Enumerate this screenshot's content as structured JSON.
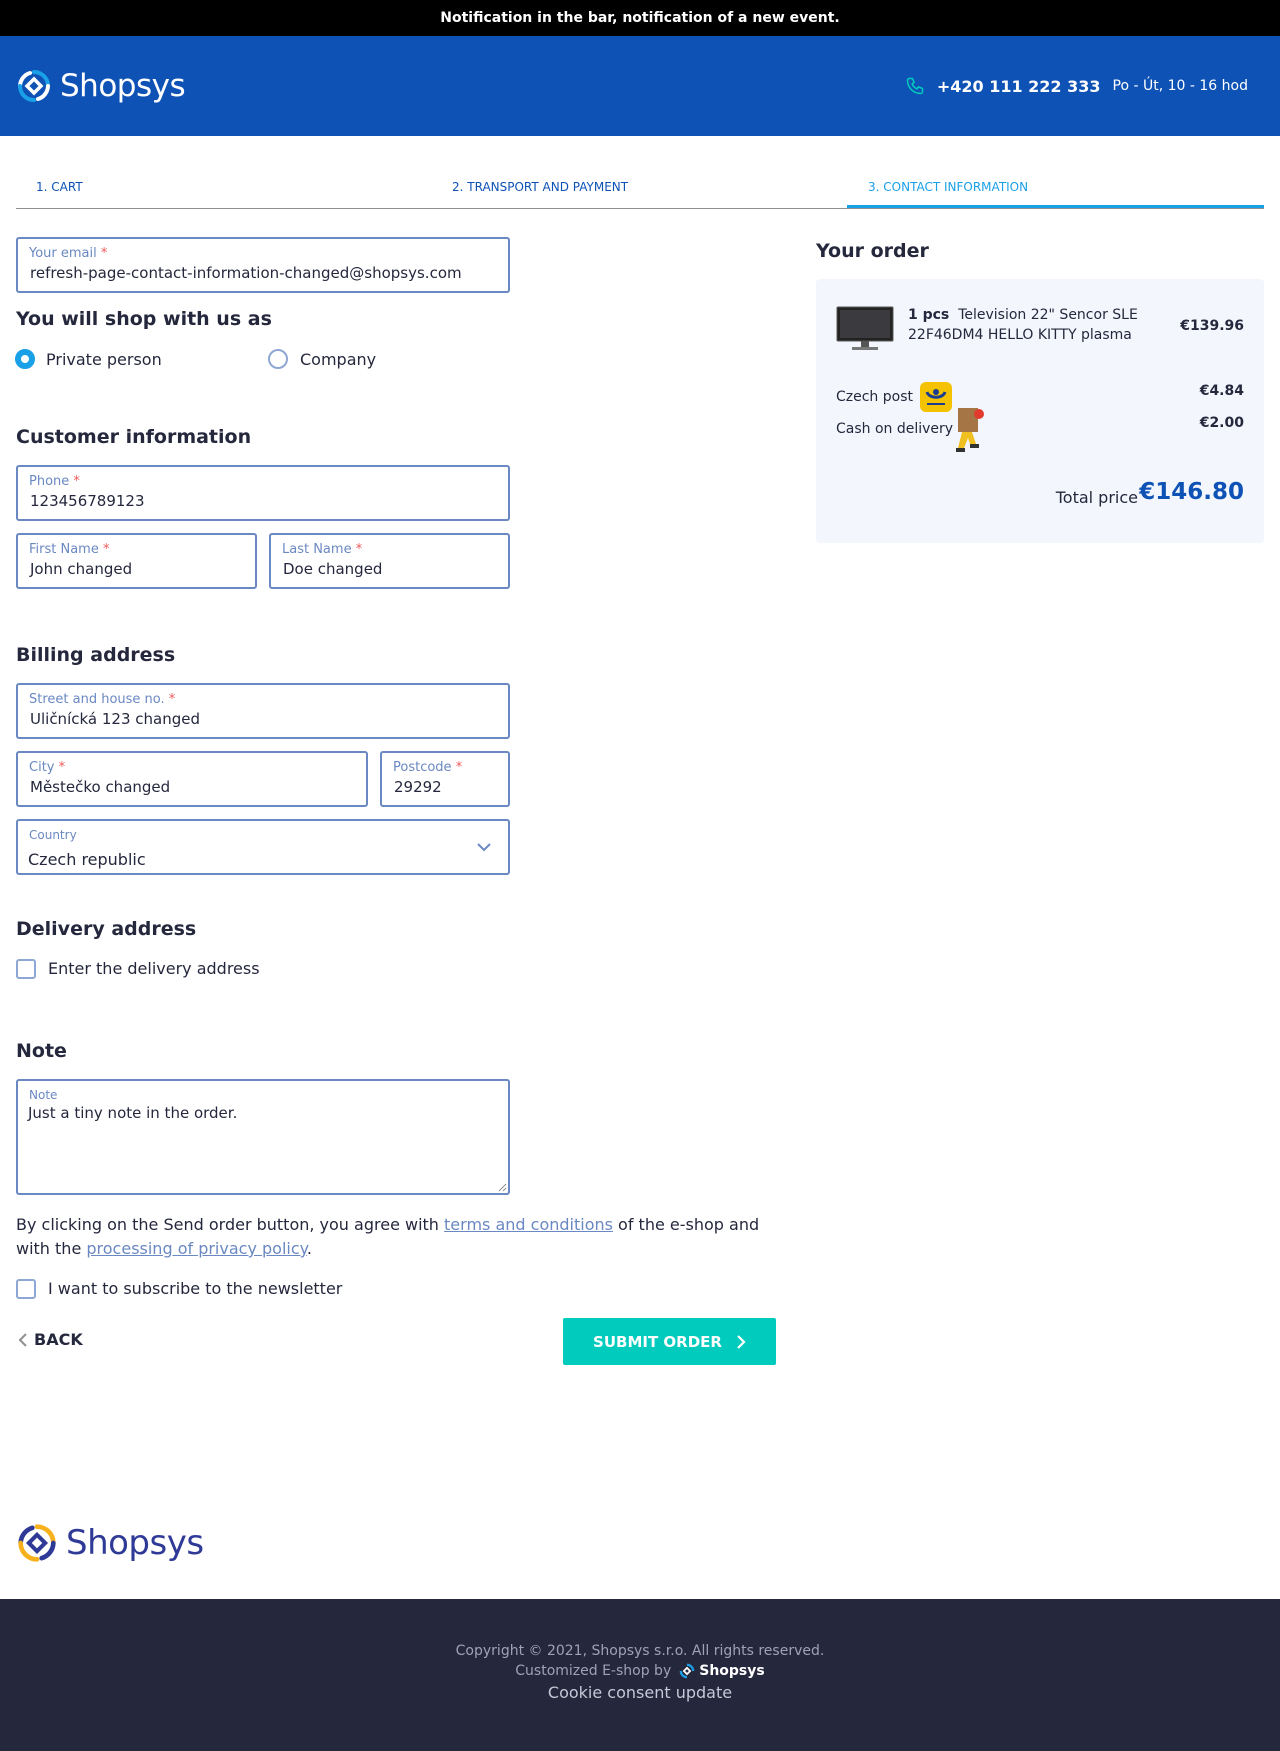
{
  "notification": "Notification in the bar, notification of a new event.",
  "header": {
    "logo_text": "Shopsys",
    "phone": "+420 111 222 333",
    "hours": "Po - Út, 10 - 16 hod"
  },
  "steps": [
    {
      "label": "1. CART"
    },
    {
      "label": "2. TRANSPORT AND PAYMENT"
    },
    {
      "label": "3. CONTACT INFORMATION"
    }
  ],
  "email": {
    "label": "Your email",
    "value": "refresh-page-contact-information-changed@shopsys.com"
  },
  "shop_as": {
    "title": "You will shop with us as",
    "options": [
      {
        "label": "Private person",
        "checked": true
      },
      {
        "label": "Company",
        "checked": false
      }
    ]
  },
  "customer": {
    "title": "Customer information",
    "phone": {
      "label": "Phone",
      "value": "123456789123"
    },
    "first_name": {
      "label": "First Name",
      "value": "John changed"
    },
    "last_name": {
      "label": "Last Name",
      "value": "Doe changed"
    }
  },
  "billing": {
    "title": "Billing address",
    "street": {
      "label": "Street and house no.",
      "value": "Uličnícká 123 changed"
    },
    "city": {
      "label": "City",
      "value": "Městečko changed"
    },
    "postcode": {
      "label": "Postcode",
      "value": "29292"
    },
    "country": {
      "label": "Country",
      "value": "Czech republic"
    }
  },
  "delivery": {
    "title": "Delivery address",
    "checkbox_label": "Enter the delivery address"
  },
  "note": {
    "title": "Note",
    "label": "Note",
    "value": "Just a tiny note in the order."
  },
  "legal": {
    "before": "By clicking on the Send order button, you agree with ",
    "terms_link": "terms and conditions",
    "middle": " of the e-shop and with the ",
    "privacy_link": "processing of privacy policy",
    "after": "."
  },
  "newsletter_label": "I want to subscribe to the newsletter",
  "actions": {
    "back": "BACK",
    "submit": "SUBMIT ORDER"
  },
  "order": {
    "title": "Your order",
    "product": {
      "qty": "1 pcs",
      "name": "Television 22\" Sencor SLE 22F46DM4 HELLO KITTY plasma",
      "price": "€139.96"
    },
    "transport": {
      "label": "Czech post",
      "price": "€4.84"
    },
    "payment": {
      "label": "Cash on delivery",
      "price": "€2.00"
    },
    "total_label": "Total price",
    "total_value": "€146.80"
  },
  "footer": {
    "logo_text": "Shopsys",
    "copyright": "Copyright © 2021, Shopsys s.r.o. All rights reserved.",
    "customized_by": "Customized E-shop by",
    "brand": "Shopsys",
    "cookie": "Cookie consent update"
  },
  "colors": {
    "brand": "#0e52b6",
    "accent": "#1aa0e7",
    "submit": "#00cbbd",
    "footer": "#25283d"
  }
}
